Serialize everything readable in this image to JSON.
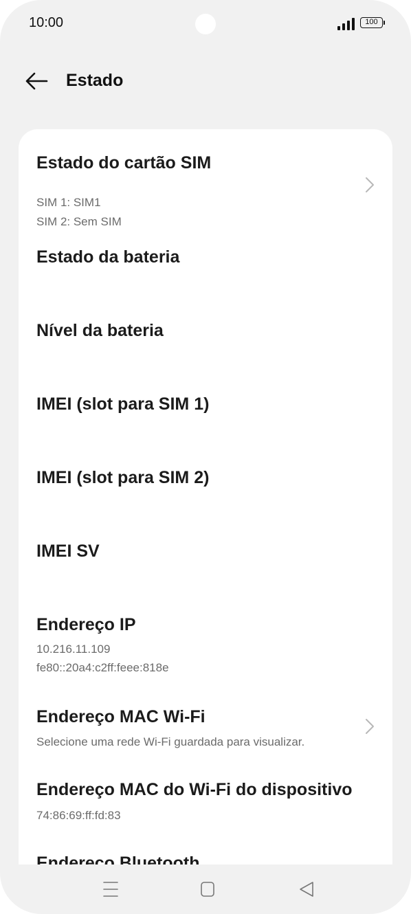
{
  "status_bar": {
    "time": "10:00",
    "battery": "100"
  },
  "header": {
    "title": "Estado"
  },
  "items": [
    {
      "title": "Estado do cartão SIM",
      "subtitle_lines": [
        "SIM 1: SIM1",
        "SIM 2: Sem SIM"
      ],
      "chevron": true
    },
    {
      "title": "Estado da bateria"
    },
    {
      "title": "Nível da bateria"
    },
    {
      "title": "IMEI (slot para SIM 1)"
    },
    {
      "title": "IMEI (slot para SIM 2)"
    },
    {
      "title": "IMEI SV"
    },
    {
      "title": "Endereço IP",
      "subtitle_lines": [
        "10.216.11.109",
        "fe80::20a4:c2ff:feee:818e"
      ]
    },
    {
      "title": "Endereço MAC Wi-Fi",
      "subtitle_lines": [
        "Selecione uma rede Wi-Fi guardada para visualizar."
      ],
      "chevron": true
    },
    {
      "title": "Endereço MAC do Wi-Fi do dispositivo",
      "subtitle_lines": [
        "74:86:69:ff:fd:83"
      ]
    },
    {
      "title": "Endereço Bluetooth"
    }
  ],
  "icons": {
    "back": "arrow-left-icon",
    "chevron": "chevron-right-icon",
    "nav_menu": "menu-icon",
    "nav_home": "home-square-icon",
    "nav_back": "triangle-back-icon"
  },
  "colors": {
    "background": "#f1f1f1",
    "card": "#ffffff",
    "title": "#1b1b1b",
    "subtitle": "#6b6b6b"
  }
}
